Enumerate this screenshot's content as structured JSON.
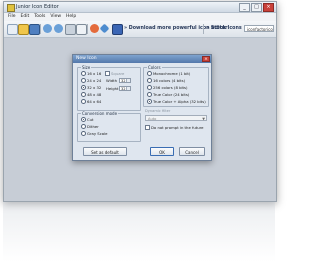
{
  "window": {
    "title": "Junior Icon Editor",
    "controls": [
      "_",
      "□",
      "×"
    ]
  },
  "menu": [
    "File",
    "Edit",
    "Tools",
    "View",
    "Help"
  ],
  "toolbar": {
    "link1": "Download more powerful icon editor",
    "link2": "Stock Icons",
    "search_value": "iconfactoricons.com",
    "icons": [
      "new-icon",
      "open-icon",
      "save-icon",
      "undo-icon",
      "redo-icon",
      "cut-icon",
      "copy-icon",
      "paste-icon",
      "delete-icon",
      "import-icon",
      "export-icon",
      "test-icon"
    ]
  },
  "dialog": {
    "title": "New Icon",
    "close": "×",
    "size": {
      "title": "Size",
      "options": [
        "16 x 16",
        "24 x 24",
        "32 x 32",
        "48 x 48",
        "64 x 64"
      ],
      "selected": "32 x 32",
      "square_label": "Square",
      "width_label": "Width",
      "width_value": "32",
      "height_label": "Height",
      "height_value": "32"
    },
    "colors": {
      "title": "Colors",
      "options": [
        "Monochrome (1 bit)",
        "16 colors (4 bits)",
        "256 colors (8 bits)",
        "True Color (24 bits)",
        "True Color + Alpha (32 bits)"
      ],
      "selected": "True Color + Alpha (32 bits)"
    },
    "conversion": {
      "title": "Conversion mode",
      "options": [
        "Cut",
        "Dither",
        "Gray Scale"
      ],
      "selected": "Cut"
    },
    "dynamic_filter": {
      "label": "Dynamic filter",
      "value": "Auto"
    },
    "do_not_prompt": "Do not prompt in the future",
    "buttons": {
      "set_default": "Set as default",
      "ok": "OK",
      "cancel": "Cancel"
    }
  }
}
